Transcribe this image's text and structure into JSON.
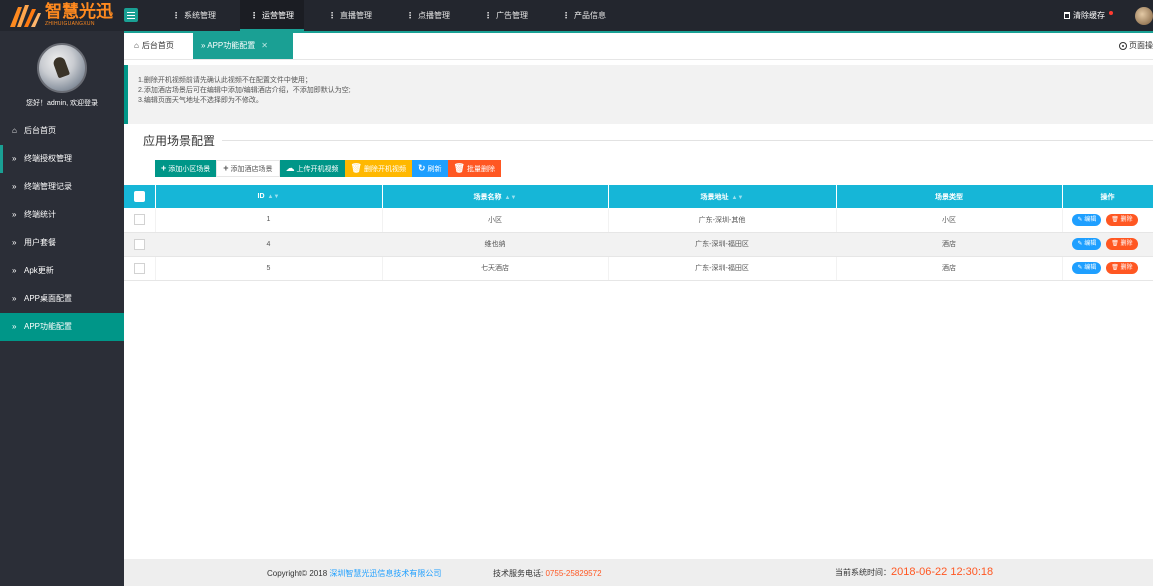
{
  "logo": {
    "title": "智慧光迅",
    "subtitle": "ZHIHUIGUANGXUN"
  },
  "topnav": [
    {
      "label": "系统管理"
    },
    {
      "label": "运营管理"
    },
    {
      "label": "直播管理"
    },
    {
      "label": "点播管理"
    },
    {
      "label": "广告管理"
    },
    {
      "label": "产品信息"
    }
  ],
  "topnav_active": "运营管理",
  "header": {
    "clear_cache": "清除缓存"
  },
  "user": {
    "welcome": "您好！admin, 欢迎登录"
  },
  "sidebar": {
    "items": [
      {
        "label": "后台首页",
        "icon": "home-icon"
      },
      {
        "label": "终端授权管理",
        "icon": "double-chevron-icon"
      },
      {
        "label": "终端管理记录",
        "icon": "double-chevron-icon"
      },
      {
        "label": "终端统计",
        "icon": "double-chevron-icon"
      },
      {
        "label": "用户套餐",
        "icon": "double-chevron-icon"
      },
      {
        "label": "Apk更新",
        "icon": "double-chevron-icon"
      },
      {
        "label": "APP桌面配置",
        "icon": "double-chevron-icon"
      },
      {
        "label": "APP功能配置",
        "icon": "double-chevron-icon"
      }
    ],
    "active": "APP功能配置"
  },
  "tabs": {
    "home": "后台首页",
    "current": "APP功能配置",
    "page_ops": "页面操"
  },
  "notes": [
    "1.删除开机视频前请先确认此视频不在配置文件中使用；",
    "2.添加酒店场景后可在编辑中添加/编辑酒店介绍，不添加即默认为空;",
    "3.编辑页面天气地址不选择即为不修改。"
  ],
  "section": {
    "title": "应用场景配置"
  },
  "toolbar": {
    "add_community": "添加小区场景",
    "add_hotel": "添加酒店场景",
    "upload_video": "上传开机视频",
    "delete_video": "删除开机视频",
    "refresh": "刷新",
    "batch_delete": "批量删除"
  },
  "table": {
    "headers": {
      "id": "ID",
      "name": "场景名称",
      "address": "场景地址",
      "type": "场景类型",
      "ops": "操作"
    },
    "rows": [
      {
        "id": "1",
        "name": "小区",
        "address": "广东-深圳-其他",
        "type": "小区"
      },
      {
        "id": "4",
        "name": "维也纳",
        "address": "广东-深圳-福田区",
        "type": "酒店"
      },
      {
        "id": "5",
        "name": "七天酒店",
        "address": "广东-深圳-福田区",
        "type": "酒店"
      }
    ],
    "edit_label": "编辑",
    "delete_label": "删除"
  },
  "footer": {
    "copyright": "Copyright© 2018",
    "company": "深圳智慧光迅信息技术有限公司",
    "phone_label": "技术服务电话:",
    "phone": "0755-25829572",
    "time_label": "当前系统时间：",
    "time": "2018-06-22 12:30:18"
  },
  "colors": {
    "accent": "#009688",
    "table_header": "#16b6d7",
    "sidebar": "#2b2e37",
    "topbar": "#23262e",
    "danger": "#ff5722",
    "info": "#1e9fff",
    "warn": "#ffb800",
    "logo": "#ff8a1f"
  }
}
